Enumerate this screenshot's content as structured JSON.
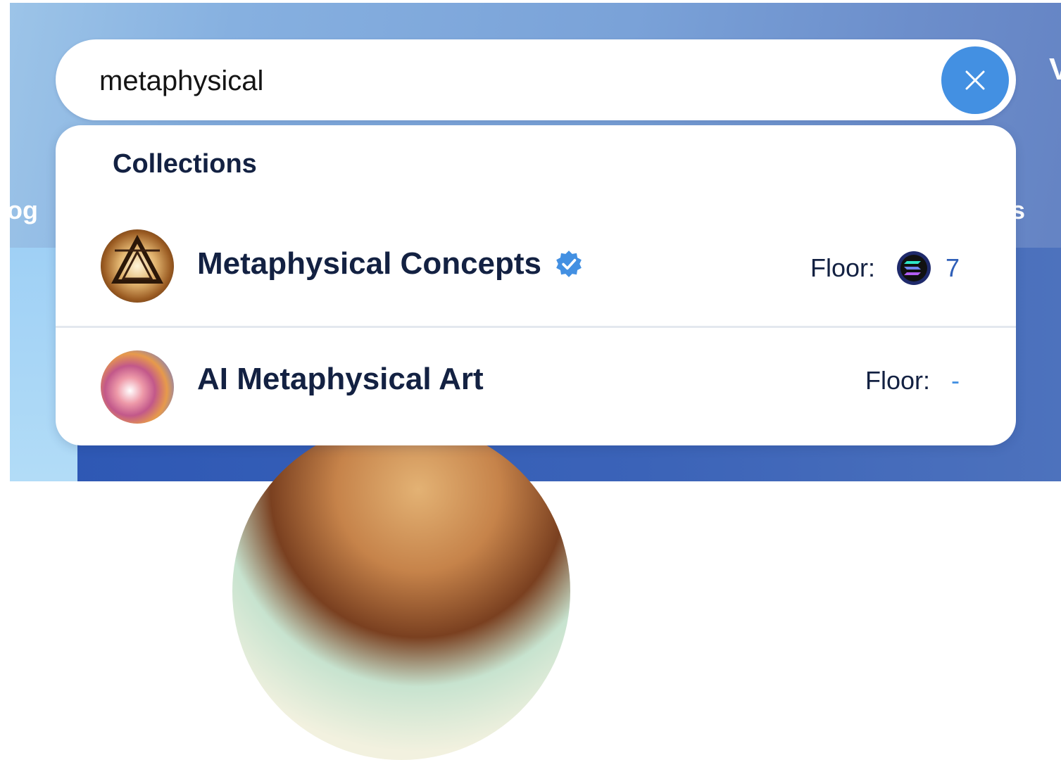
{
  "search": {
    "value": "metaphysical",
    "clear_icon": "close-icon"
  },
  "dropdown": {
    "section_title": "Collections",
    "results": [
      {
        "name": "Metaphysical Concepts",
        "verified": true,
        "floor_label": "Floor:",
        "floor_currency_icon": "solana-icon",
        "floor_value": "7"
      },
      {
        "name": "AI Metaphysical Art",
        "verified": false,
        "floor_label": "Floor:",
        "floor_value": "-"
      }
    ]
  },
  "background": {
    "partial_text_left": "og",
    "partial_text_right": "s"
  },
  "colors": {
    "accent": "#4390e2",
    "text_dark": "#132142",
    "floor_value": "#2f5fb8"
  }
}
